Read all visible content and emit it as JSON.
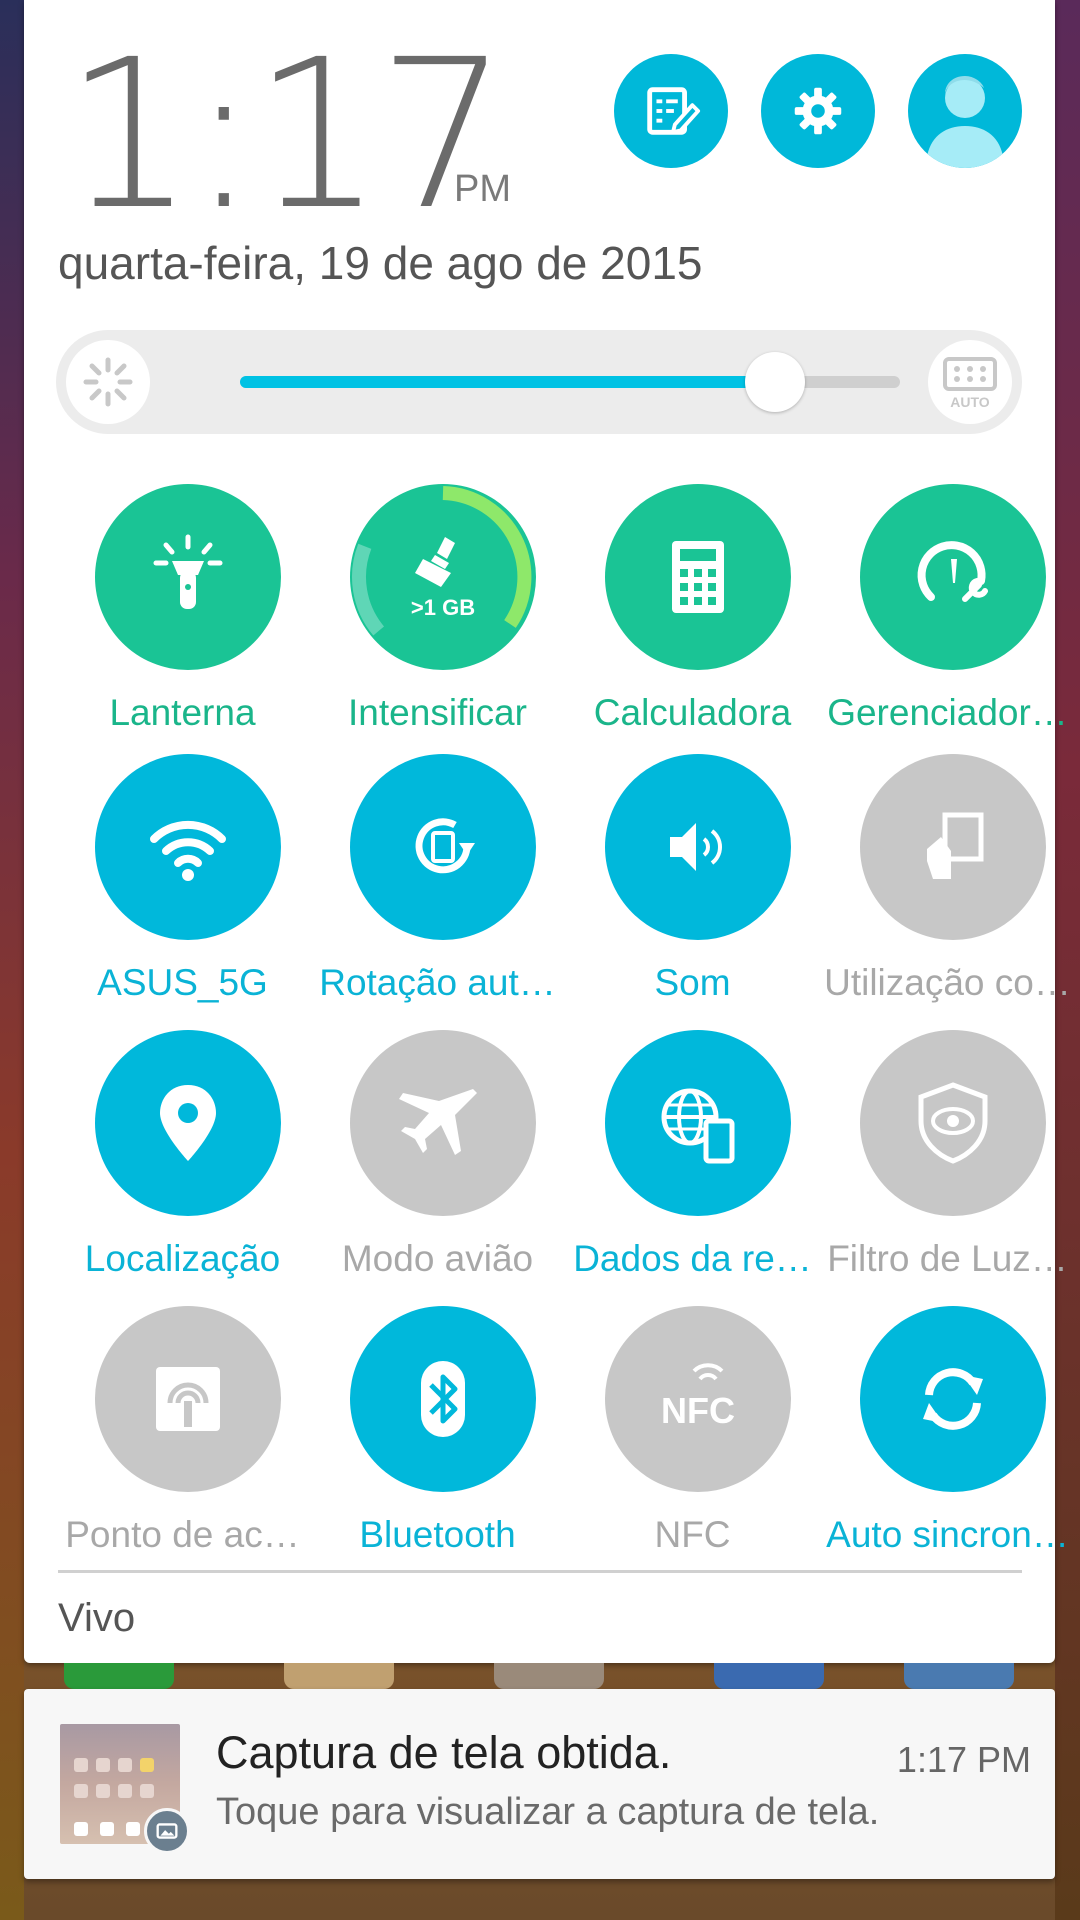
{
  "clock": {
    "time": "1:17",
    "ampm": "PM"
  },
  "date": "quarta-feira, 19 de ago de 2015",
  "top_buttons": [
    {
      "name": "quick-settings-edit-icon"
    },
    {
      "name": "settings-gear-icon"
    },
    {
      "name": "user-avatar-icon"
    }
  ],
  "brightness": {
    "level": 0.81,
    "auto_label": "AUTO"
  },
  "tiles": [
    {
      "label": "Lanterna",
      "icon": "flashlight-icon",
      "state": "green"
    },
    {
      "label": "Intensificar",
      "icon": "boost-broom-icon",
      "state": "green",
      "badge": ">1 GB"
    },
    {
      "label": "Calculadora",
      "icon": "calculator-icon",
      "state": "green"
    },
    {
      "label": "Gerenciador…",
      "icon": "manager-gauge-icon",
      "state": "green"
    },
    {
      "label": "ASUS_5G",
      "icon": "wifi-icon",
      "state": "blue"
    },
    {
      "label": "Rotação aut…",
      "icon": "auto-rotate-icon",
      "state": "blue"
    },
    {
      "label": "Som",
      "icon": "sound-icon",
      "state": "blue"
    },
    {
      "label": "Utilização co…",
      "icon": "one-hand-mode-icon",
      "state": "gray"
    },
    {
      "label": "Localização",
      "icon": "location-pin-icon",
      "state": "blue"
    },
    {
      "label": "Modo avião",
      "icon": "airplane-icon",
      "state": "gray"
    },
    {
      "label": "Dados da re…",
      "icon": "mobile-data-globe-icon",
      "state": "blue"
    },
    {
      "label": "Filtro de Luz…",
      "icon": "blue-light-filter-icon",
      "state": "gray"
    },
    {
      "label": "Ponto de ac…",
      "icon": "hotspot-icon",
      "state": "gray"
    },
    {
      "label": "Bluetooth",
      "icon": "bluetooth-icon",
      "state": "blue"
    },
    {
      "label": "NFC",
      "icon": "nfc-icon",
      "state": "gray"
    },
    {
      "label": "Auto sincron…",
      "icon": "sync-icon",
      "state": "blue"
    }
  ],
  "carrier": "Vivo",
  "notification": {
    "title": "Captura de tela obtida.",
    "time": "1:17 PM",
    "text": "Toque para visualizar a captura de tela."
  }
}
